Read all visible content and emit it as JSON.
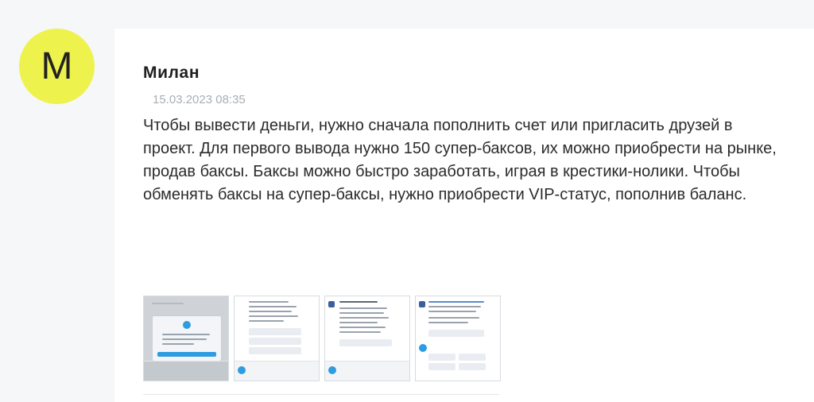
{
  "comment": {
    "avatar_letter": "М",
    "avatar_color": "#eef24d",
    "author": "Милан",
    "date": "15.03.2023 08:35",
    "text": "Чтобы вывести деньги, нужно сначала пополнить счет или пригласить друзей в проект. Для первого вывода нужно 150 супер-баксов, их можно приобрести на рынке, продав баксы. Баксы можно быстро заработать, играя в крестики-нолики. Чтобы обменять баксы на супер-баксы, нужно приобрести VIP-статус, пополнив баланс."
  },
  "attachments": {
    "thumbnails": [
      {
        "icon": "telegram-dialog-screenshot"
      },
      {
        "icon": "chat-menu-screenshot"
      },
      {
        "icon": "vip-status-screenshot"
      },
      {
        "icon": "balance-screenshot"
      }
    ]
  },
  "colors": {
    "telegram_blue": "#2f9ce0",
    "bot_icon_blue": "#3a5f9f"
  }
}
